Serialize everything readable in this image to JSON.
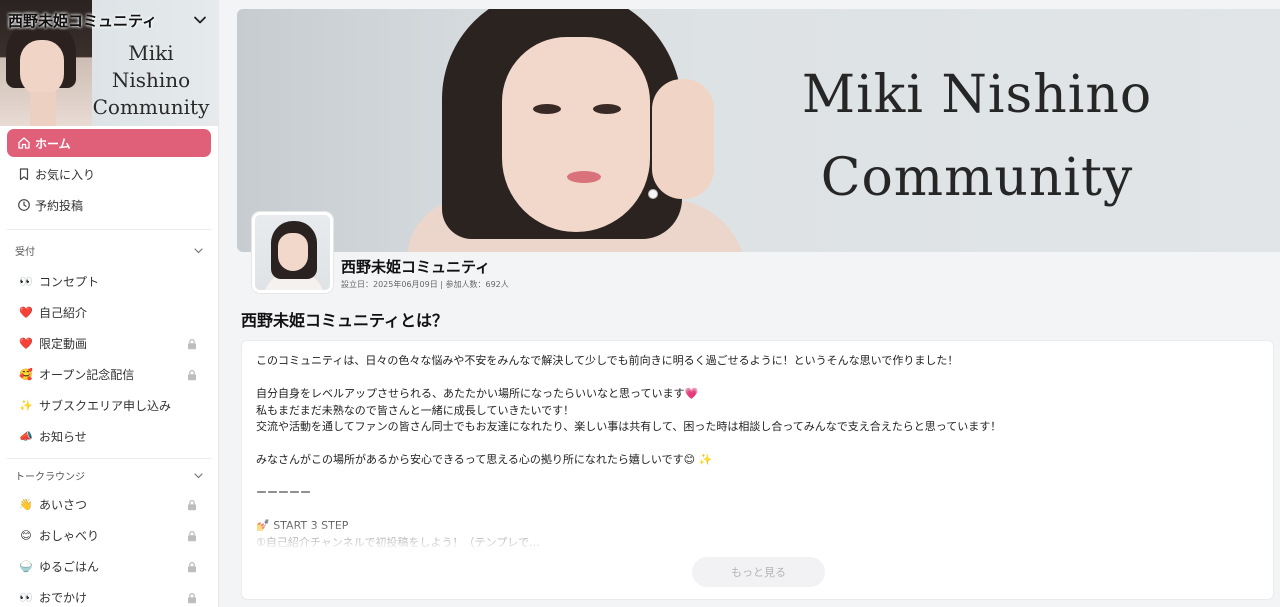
{
  "sidebar": {
    "community_title": "西野未姫コミュニティ",
    "banner_text_line1": "Miki Nishino",
    "banner_text_line2": "Community",
    "nav": [
      {
        "label": "ホーム",
        "icon": "home-icon",
        "active": true
      },
      {
        "label": "お気に入り",
        "icon": "bookmark-icon",
        "active": false
      },
      {
        "label": "予約投稿",
        "icon": "clock-icon",
        "active": false
      }
    ],
    "sections": [
      {
        "title": "受付",
        "channels": [
          {
            "emoji": "👀",
            "label": "コンセプト",
            "locked": false
          },
          {
            "emoji": "❤️",
            "label": "自己紹介",
            "locked": false
          },
          {
            "emoji": "❤️",
            "label": "限定動画",
            "locked": true
          },
          {
            "emoji": "🥰",
            "label": "オープン記念配信",
            "locked": true
          },
          {
            "emoji": "✨",
            "label": "サブスクエリア申し込み",
            "locked": false
          },
          {
            "emoji": "📣",
            "label": "お知らせ",
            "locked": false
          }
        ]
      },
      {
        "title": "トークラウンジ",
        "channels": [
          {
            "emoji": "👋",
            "label": "あいさつ",
            "locked": true
          },
          {
            "emoji": "😊",
            "label": "おしゃべり",
            "locked": true
          },
          {
            "emoji": "🍚",
            "label": "ゆるごはん",
            "locked": true
          },
          {
            "emoji": "👀",
            "label": "おでかけ",
            "locked": true
          }
        ]
      }
    ]
  },
  "main": {
    "hero_text_line1": "Miki Nishino",
    "hero_text_line2": "Community",
    "community_name": "西野未姫コミュニティ",
    "meta": "設立日：2025年06月09日 | 参加人数：692人",
    "about_title": "西野未姫コミュニティとは？",
    "about_body": "このコミュニティは、日々の色々な悩みや不安をみんなで解決して少しでも前向きに明るく過ごせるように！というそんな思いで作りました！\n\n自分自身をレベルアップさせられる、あたたかい場所になったらいいなと思っています💗\n私もまだまだ未熟なので皆さんと一緒に成長していきたいです！\n交流や活動を通してファンの皆さん同士でもお友達になれたり、楽しい事は共有して、困った時は相談し合ってみんなで支え合えたらと思っています！\n\nみなさんがこの場所があるから安心できるって思える心の拠り所になれたら嬉しいです😊 ✨\n\nーーーーー\n\n💅 START 3 STEP\n①自己紹介チャンネルで初投稿をしよう！（テンプレで...",
    "more_button": "もっと見る"
  },
  "colors": {
    "accent": "#e0607a"
  }
}
